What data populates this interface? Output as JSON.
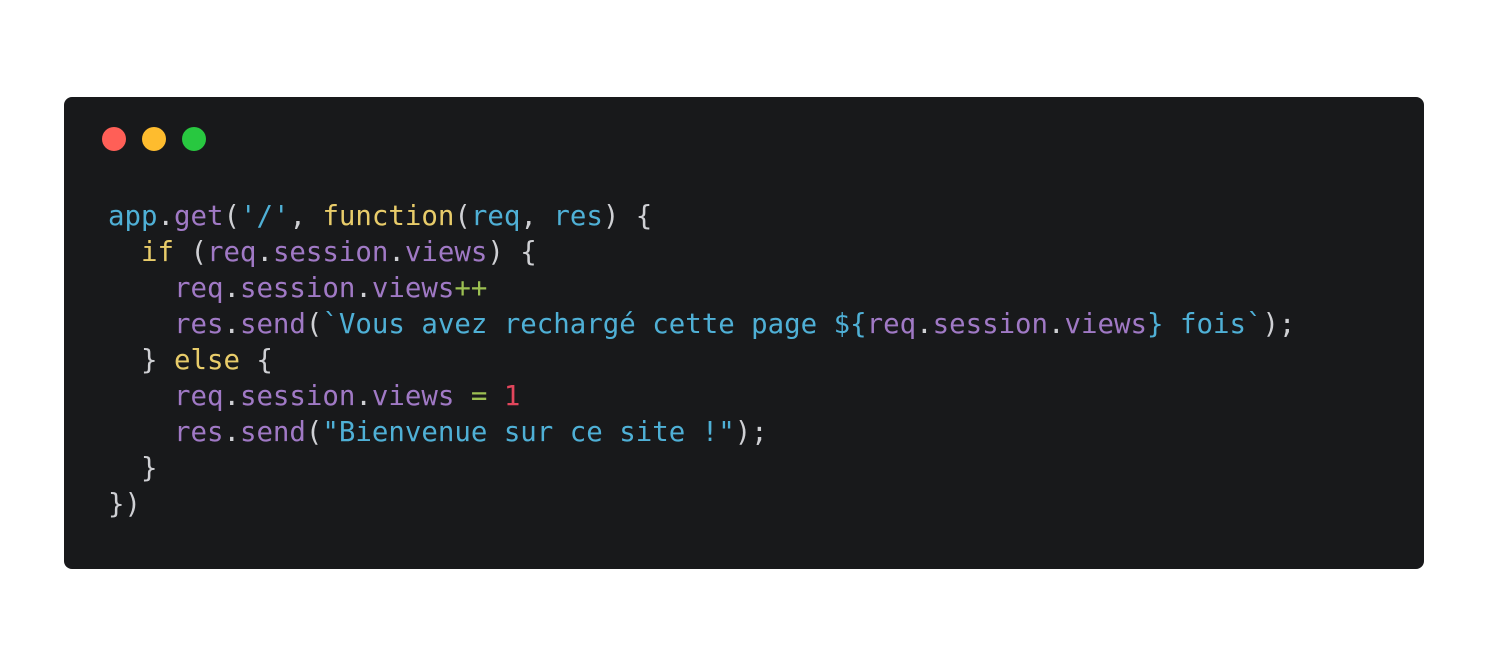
{
  "window": {
    "controls": [
      {
        "name": "close",
        "color": "#ff5f57"
      },
      {
        "name": "minimize",
        "color": "#febc2e"
      },
      {
        "name": "zoom",
        "color": "#28c840"
      }
    ]
  },
  "code": {
    "colors": {
      "plain": "#cfd0d4",
      "identifier": "#4fb0d6",
      "property": "#a079c5",
      "keyword": "#e8cc6a",
      "string": "#4fb0d6",
      "operator": "#9cc052",
      "number": "#e2465c",
      "background": "#18191b"
    },
    "lines": [
      [
        {
          "t": "app",
          "c": "id"
        },
        {
          "t": ".",
          "c": "plain"
        },
        {
          "t": "get",
          "c": "prop"
        },
        {
          "t": "(",
          "c": "plain"
        },
        {
          "t": "'/'",
          "c": "str"
        },
        {
          "t": ", ",
          "c": "plain"
        },
        {
          "t": "function",
          "c": "kw"
        },
        {
          "t": "(",
          "c": "plain"
        },
        {
          "t": "req",
          "c": "id"
        },
        {
          "t": ", ",
          "c": "plain"
        },
        {
          "t": "res",
          "c": "id"
        },
        {
          "t": ") {",
          "c": "plain"
        }
      ],
      [
        {
          "t": "  ",
          "c": "plain"
        },
        {
          "t": "if",
          "c": "kw"
        },
        {
          "t": " (",
          "c": "plain"
        },
        {
          "t": "req",
          "c": "prop"
        },
        {
          "t": ".",
          "c": "plain"
        },
        {
          "t": "session",
          "c": "prop"
        },
        {
          "t": ".",
          "c": "plain"
        },
        {
          "t": "views",
          "c": "prop"
        },
        {
          "t": ") {",
          "c": "plain"
        }
      ],
      [
        {
          "t": "    ",
          "c": "plain"
        },
        {
          "t": "req",
          "c": "prop"
        },
        {
          "t": ".",
          "c": "plain"
        },
        {
          "t": "session",
          "c": "prop"
        },
        {
          "t": ".",
          "c": "plain"
        },
        {
          "t": "views",
          "c": "prop"
        },
        {
          "t": "++",
          "c": "op"
        }
      ],
      [
        {
          "t": "    ",
          "c": "plain"
        },
        {
          "t": "res",
          "c": "prop"
        },
        {
          "t": ".",
          "c": "plain"
        },
        {
          "t": "send",
          "c": "prop"
        },
        {
          "t": "(",
          "c": "plain"
        },
        {
          "t": "`Vous avez rechargé cette page ${",
          "c": "str"
        },
        {
          "t": "req",
          "c": "prop"
        },
        {
          "t": ".",
          "c": "plain"
        },
        {
          "t": "session",
          "c": "prop"
        },
        {
          "t": ".",
          "c": "plain"
        },
        {
          "t": "views",
          "c": "prop"
        },
        {
          "t": "} fois`",
          "c": "str"
        },
        {
          "t": ");",
          "c": "plain"
        }
      ],
      [
        {
          "t": "  } ",
          "c": "plain"
        },
        {
          "t": "else",
          "c": "kw"
        },
        {
          "t": " {",
          "c": "plain"
        }
      ],
      [
        {
          "t": "    ",
          "c": "plain"
        },
        {
          "t": "req",
          "c": "prop"
        },
        {
          "t": ".",
          "c": "plain"
        },
        {
          "t": "session",
          "c": "prop"
        },
        {
          "t": ".",
          "c": "plain"
        },
        {
          "t": "views",
          "c": "prop"
        },
        {
          "t": " ",
          "c": "plain"
        },
        {
          "t": "=",
          "c": "op"
        },
        {
          "t": " ",
          "c": "plain"
        },
        {
          "t": "1",
          "c": "num"
        }
      ],
      [
        {
          "t": "    ",
          "c": "plain"
        },
        {
          "t": "res",
          "c": "prop"
        },
        {
          "t": ".",
          "c": "plain"
        },
        {
          "t": "send",
          "c": "prop"
        },
        {
          "t": "(",
          "c": "plain"
        },
        {
          "t": "\"Bienvenue sur ce site !\"",
          "c": "str"
        },
        {
          "t": ");",
          "c": "plain"
        }
      ],
      [
        {
          "t": "  }",
          "c": "plain"
        }
      ],
      [
        {
          "t": "})",
          "c": "plain"
        }
      ]
    ]
  }
}
